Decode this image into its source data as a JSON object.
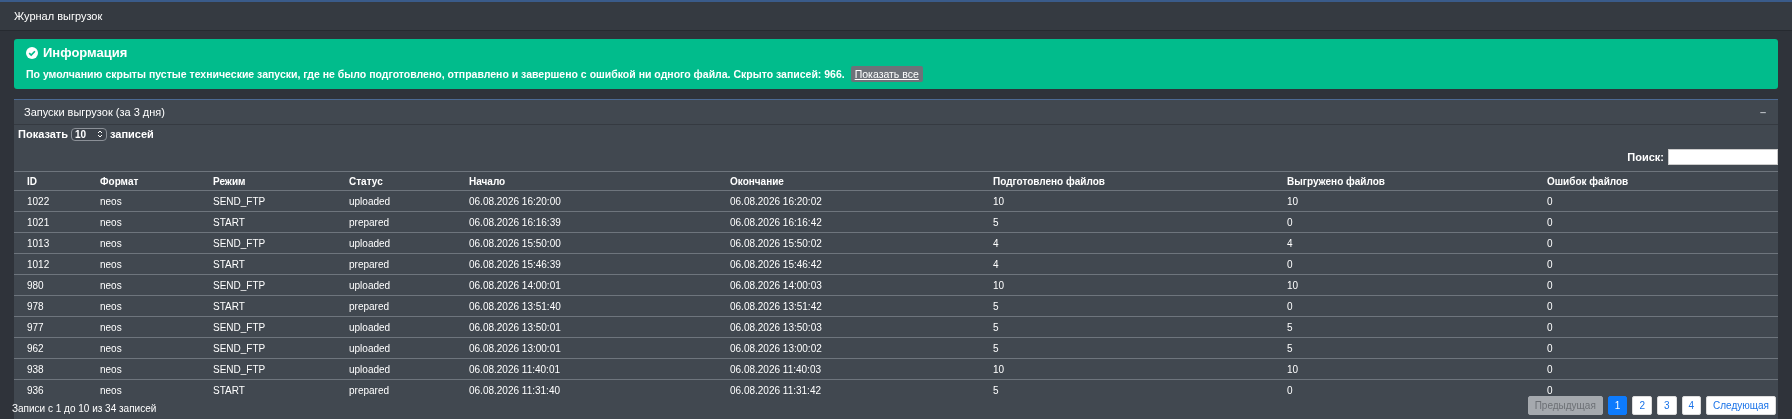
{
  "page_title": "Журнал выгрузок",
  "alert": {
    "title": "Информация",
    "message": "По умолчанию скрыты пустые технические запуски, где не было подготовлено, отправлено и завершено с ошибкой ни одного файла. Скрыто записей: 966.",
    "link": "Показать все"
  },
  "panel": {
    "title": "Запуски выгрузок (за 3 дня)",
    "collapse": "–",
    "length_before": "Показать",
    "length_value": "10",
    "length_after": "записей",
    "search_label": "Поиск:",
    "table": {
      "columns": [
        "ID",
        "Формат",
        "Режим",
        "Статус",
        "Начало",
        "Окончание",
        "Подготовлено файлов",
        "Выгружено файлов",
        "Ошибок файлов"
      ],
      "rows": [
        [
          "1022",
          "neos",
          "SEND_FTP",
          "uploaded",
          "06.08.2026 16:20:00",
          "06.08.2026 16:20:02",
          "10",
          "10",
          "0"
        ],
        [
          "1021",
          "neos",
          "START",
          "prepared",
          "06.08.2026 16:16:39",
          "06.08.2026 16:16:42",
          "5",
          "0",
          "0"
        ],
        [
          "1013",
          "neos",
          "SEND_FTP",
          "uploaded",
          "06.08.2026 15:50:00",
          "06.08.2026 15:50:02",
          "4",
          "4",
          "0"
        ],
        [
          "1012",
          "neos",
          "START",
          "prepared",
          "06.08.2026 15:46:39",
          "06.08.2026 15:46:42",
          "4",
          "0",
          "0"
        ],
        [
          "980",
          "neos",
          "SEND_FTP",
          "uploaded",
          "06.08.2026 14:00:01",
          "06.08.2026 14:00:03",
          "10",
          "10",
          "0"
        ],
        [
          "978",
          "neos",
          "START",
          "prepared",
          "06.08.2026 13:51:40",
          "06.08.2026 13:51:42",
          "5",
          "0",
          "0"
        ],
        [
          "977",
          "neos",
          "SEND_FTP",
          "uploaded",
          "06.08.2026 13:50:01",
          "06.08.2026 13:50:03",
          "5",
          "5",
          "0"
        ],
        [
          "962",
          "neos",
          "SEND_FTP",
          "uploaded",
          "06.08.2026 13:00:01",
          "06.08.2026 13:00:02",
          "5",
          "5",
          "0"
        ],
        [
          "938",
          "neos",
          "SEND_FTP",
          "uploaded",
          "06.08.2026 11:40:01",
          "06.08.2026 11:40:03",
          "10",
          "10",
          "0"
        ],
        [
          "936",
          "neos",
          "START",
          "prepared",
          "06.08.2026 11:31:40",
          "06.08.2026 11:31:42",
          "5",
          "0",
          "0"
        ]
      ]
    },
    "info": "Записи с 1 до 10 из 34 записей",
    "pagination": [
      {
        "label": "Предыдущая",
        "selected": false,
        "disabled": true
      },
      {
        "label": "1",
        "selected": true,
        "disabled": false
      },
      {
        "label": "2",
        "selected": false,
        "disabled": false
      },
      {
        "label": "3",
        "selected": false,
        "disabled": false
      },
      {
        "label": "4",
        "selected": false,
        "disabled": false
      },
      {
        "label": "Следующая",
        "selected": false,
        "disabled": false
      }
    ]
  }
}
